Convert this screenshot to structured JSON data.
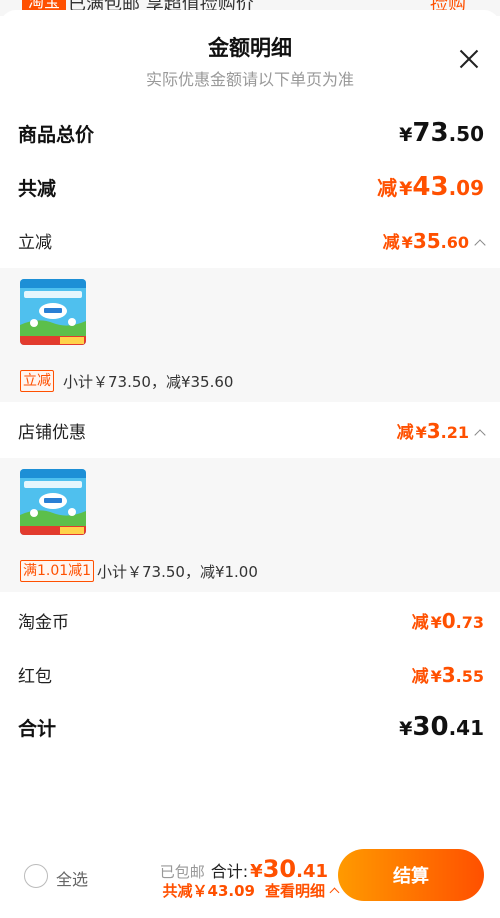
{
  "peek": {
    "badge": "淘宝",
    "text": "已满包邮 享超值捡购价",
    "right": "捡购"
  },
  "header": {
    "title": "金额明细",
    "subtitle": "实际优惠金额请以下单页为准"
  },
  "summary": {
    "total_label": "商品总价",
    "total_yen": "¥",
    "total_int": "73",
    "total_dec": ".50",
    "reduce_label": "共减",
    "reduce_prefix": "减",
    "reduce_yen": "¥",
    "reduce_int": "43",
    "reduce_dec": ".09"
  },
  "instant": {
    "label": "立减",
    "prefix": "减",
    "yen": "¥",
    "int": "35",
    "dec": ".60",
    "tag": "立减",
    "detail": "小计￥73.50，减¥35.60"
  },
  "store": {
    "label": "店铺优惠",
    "prefix": "减",
    "yen": "¥",
    "int": "3",
    "dec": ".21",
    "tag": "满1.01减1",
    "detail": "小计￥73.50，减¥1.00"
  },
  "coins": {
    "label": "淘金币",
    "prefix": "减",
    "yen": "¥",
    "int": "0",
    "dec": ".73"
  },
  "redpacket": {
    "label": "红包",
    "prefix": "减",
    "yen": "¥",
    "int": "3",
    "dec": ".55"
  },
  "total": {
    "label": "合计",
    "yen": "¥",
    "int": "30",
    "dec": ".41"
  },
  "bottom": {
    "select_all": "全选",
    "free_shipping": "已包邮",
    "total_label": "合计:",
    "yen": "¥",
    "int": "30",
    "dec": ".41",
    "reduce_text": "共减￥43.09",
    "detail_link": "查看明细",
    "checkout": "结算"
  },
  "colors": {
    "accent": "#ff5000",
    "accent_gradient_start": "#ff9a00"
  },
  "icons": {
    "close": "close-icon",
    "chevron": "chevron-up-icon",
    "radio": "radio-circle-icon"
  }
}
